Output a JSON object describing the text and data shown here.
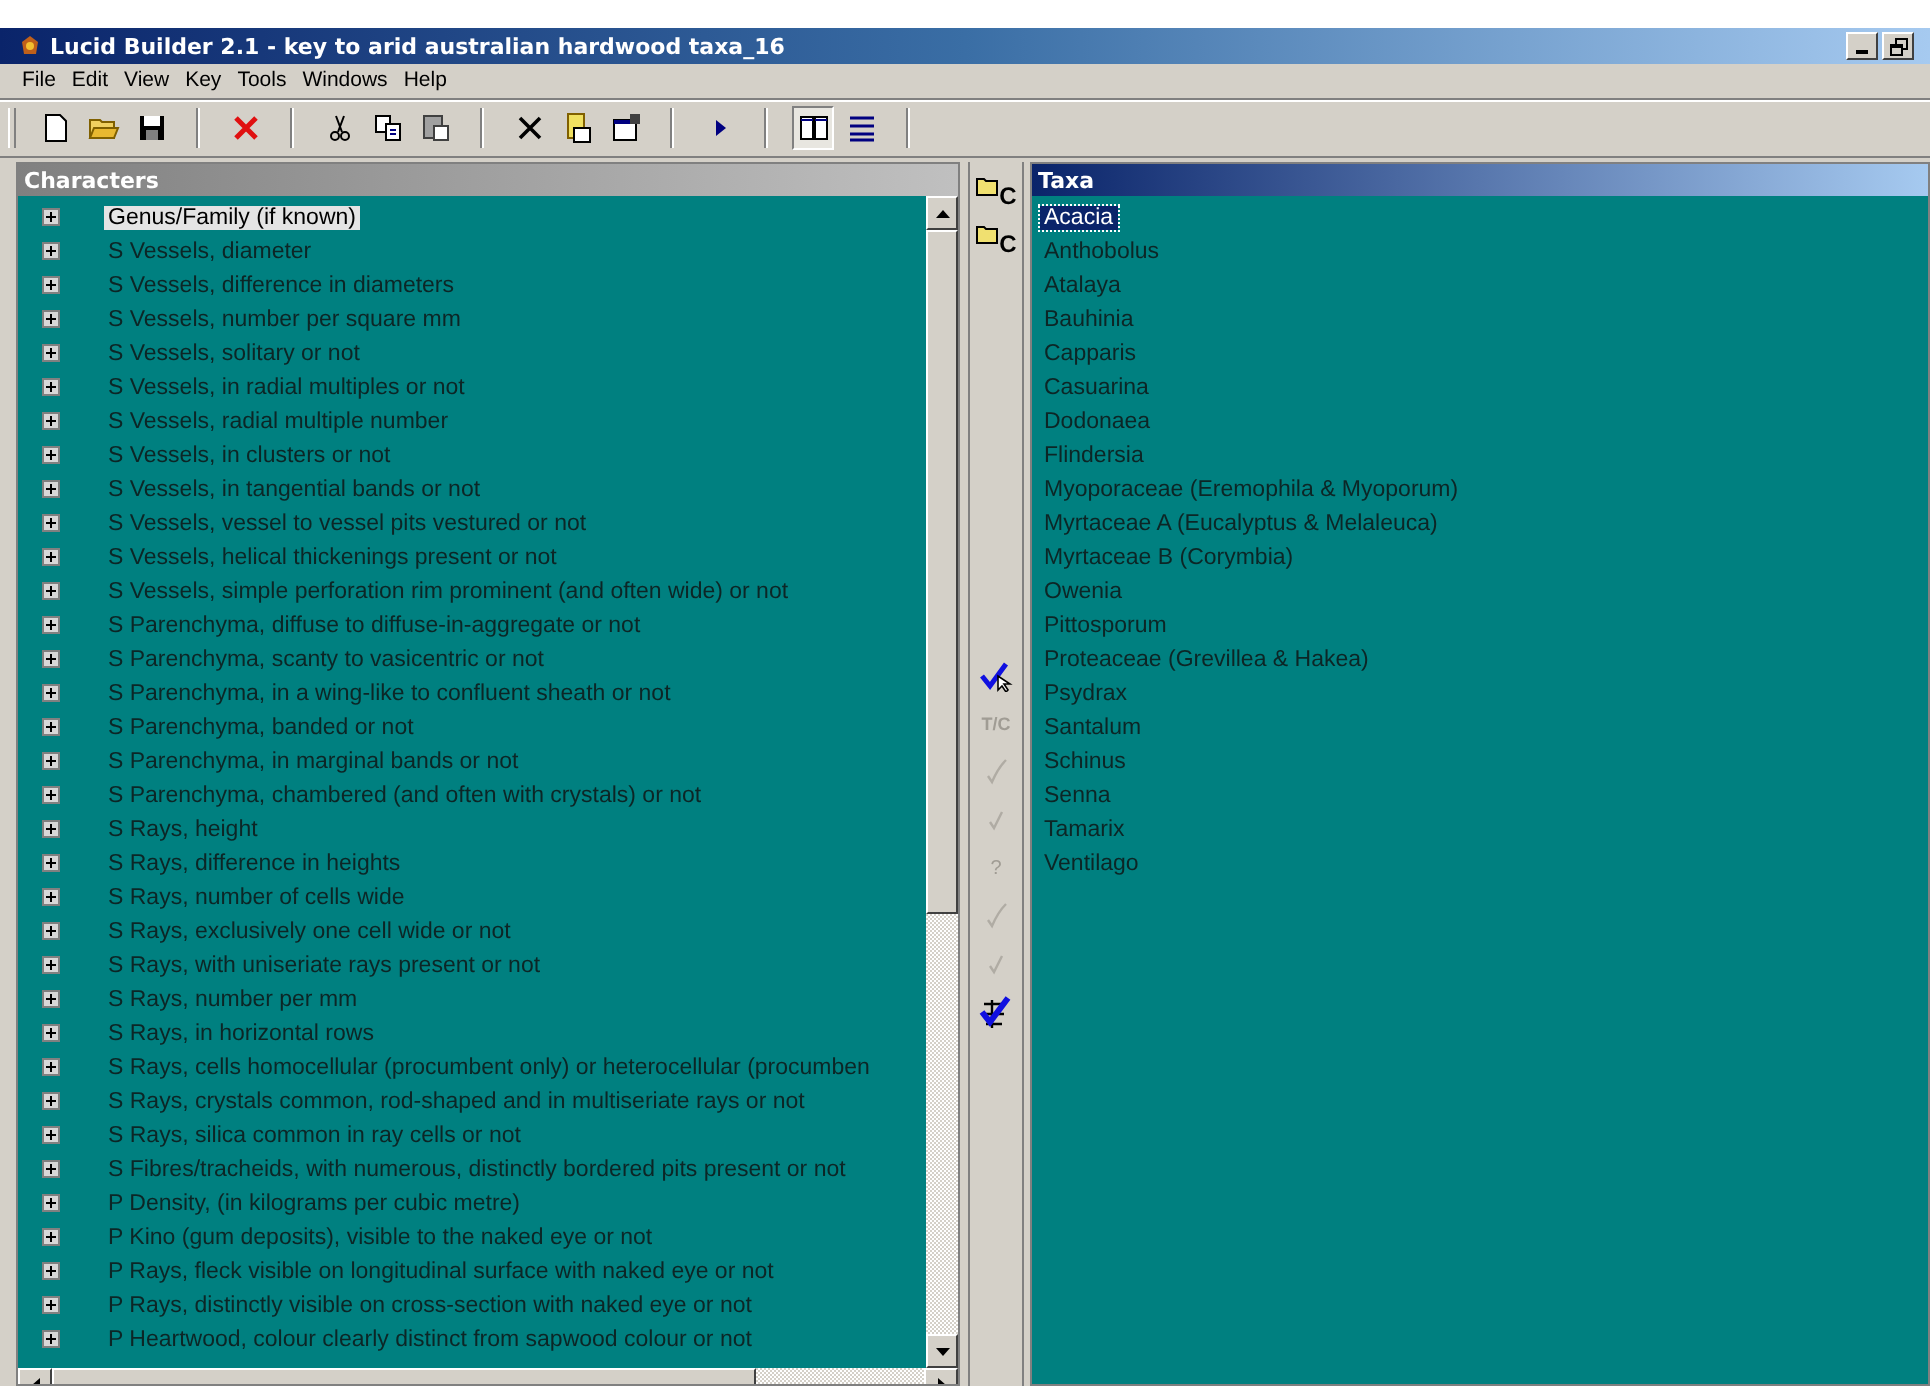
{
  "window": {
    "title": "Lucid Builder 2.1 - key to arid australian hardwood taxa_16"
  },
  "menu": [
    "File",
    "Edit",
    "View",
    "Key",
    "Tools",
    "Windows",
    "Help"
  ],
  "toolbar": [
    {
      "kind": "new"
    },
    {
      "kind": "open"
    },
    {
      "kind": "save"
    },
    {
      "kind": "sep"
    },
    {
      "kind": "delete"
    },
    {
      "kind": "sep"
    },
    {
      "kind": "cut"
    },
    {
      "kind": "copy"
    },
    {
      "kind": "paste"
    },
    {
      "kind": "sep"
    },
    {
      "kind": "remove"
    },
    {
      "kind": "clipboard"
    },
    {
      "kind": "properties"
    },
    {
      "kind": "sep"
    },
    {
      "kind": "run"
    },
    {
      "kind": "sep"
    }
  ],
  "view_toggles": [
    {
      "kind": "columns",
      "selected": true
    },
    {
      "kind": "rows",
      "selected": false
    }
  ],
  "characters": {
    "title": "Characters",
    "items": [
      {
        "label": "Genus/Family (if known)",
        "selected": true
      },
      {
        "label": "S Vessels, diameter",
        "selected": false
      },
      {
        "label": "S Vessels, difference in diameters",
        "selected": false
      },
      {
        "label": "S Vessels, number per square mm",
        "selected": false
      },
      {
        "label": "S Vessels, solitary or not",
        "selected": false
      },
      {
        "label": "S Vessels, in radial multiples or not",
        "selected": false
      },
      {
        "label": "S Vessels, radial multiple number",
        "selected": false
      },
      {
        "label": "S Vessels, in clusters or not",
        "selected": false
      },
      {
        "label": "S Vessels, in tangential bands or not",
        "selected": false
      },
      {
        "label": "S Vessels, vessel to vessel pits vestured or not",
        "selected": false
      },
      {
        "label": "S Vessels, helical thickenings present or not",
        "selected": false
      },
      {
        "label": "S Vessels, simple perforation rim prominent (and often wide) or not",
        "selected": false
      },
      {
        "label": "S Parenchyma, diffuse to diffuse-in-aggregate or not",
        "selected": false
      },
      {
        "label": "S Parenchyma, scanty to vasicentric or not",
        "selected": false
      },
      {
        "label": "S Parenchyma, in a wing-like to confluent sheath or not",
        "selected": false
      },
      {
        "label": "S Parenchyma, banded or not",
        "selected": false
      },
      {
        "label": "S Parenchyma, in marginal bands or not",
        "selected": false
      },
      {
        "label": "S Parenchyma, chambered (and often with crystals) or not",
        "selected": false
      },
      {
        "label": "S Rays, height",
        "selected": false
      },
      {
        "label": "S Rays, difference in heights",
        "selected": false
      },
      {
        "label": "S Rays, number of cells wide",
        "selected": false
      },
      {
        "label": "S Rays, exclusively one cell wide or not",
        "selected": false
      },
      {
        "label": "S Rays, with uniseriate rays present or not",
        "selected": false
      },
      {
        "label": "S Rays, number per mm",
        "selected": false
      },
      {
        "label": "S Rays, in horizontal rows",
        "selected": false
      },
      {
        "label": "S Rays, cells homocellular (procumbent only) or heterocellular (procumben",
        "selected": false
      },
      {
        "label": "S Rays, crystals common, rod-shaped and in multiseriate rays or not",
        "selected": false
      },
      {
        "label": "S Rays, silica common in ray cells or not",
        "selected": false
      },
      {
        "label": "S Fibres/tracheids, with numerous, distinctly bordered pits present or not",
        "selected": false
      },
      {
        "label": "P Density, (in kilograms per cubic metre)",
        "selected": false
      },
      {
        "label": "P Kino (gum deposits), visible to the naked eye or not",
        "selected": false
      },
      {
        "label": "P Rays, fleck visible on longitudinal surface with naked eye or not",
        "selected": false
      },
      {
        "label": "P Rays, distinctly visible on cross-section with naked eye or not",
        "selected": false
      },
      {
        "label": "P Heartwood, colour clearly distinct from sapwood colour or not",
        "selected": false
      }
    ]
  },
  "strip": [
    {
      "kind": "folder",
      "label": "C",
      "disabled": false
    },
    {
      "kind": "folder",
      "label": "C",
      "disabled": false
    },
    {
      "kind": "check-cursor",
      "disabled": false
    },
    {
      "kind": "tc",
      "label": "T/C",
      "disabled": true
    },
    {
      "kind": "check",
      "disabled": true
    },
    {
      "kind": "check-small",
      "disabled": true
    },
    {
      "kind": "question",
      "label": "?",
      "disabled": true
    },
    {
      "kind": "check",
      "disabled": true
    },
    {
      "kind": "check-small",
      "disabled": true
    },
    {
      "kind": "check-tasks",
      "disabled": false
    }
  ],
  "taxa": {
    "title": "Taxa",
    "items": [
      {
        "label": "Acacia",
        "selected": true
      },
      {
        "label": "Anthobolus",
        "selected": false
      },
      {
        "label": "Atalaya",
        "selected": false
      },
      {
        "label": "Bauhinia",
        "selected": false
      },
      {
        "label": "Capparis",
        "selected": false
      },
      {
        "label": "Casuarina",
        "selected": false
      },
      {
        "label": "Dodonaea",
        "selected": false
      },
      {
        "label": "Flindersia",
        "selected": false
      },
      {
        "label": "Myoporaceae (Eremophila & Myoporum)",
        "selected": false
      },
      {
        "label": "Myrtaceae A (Eucalyptus & Melaleuca)",
        "selected": false
      },
      {
        "label": "Myrtaceae B (Corymbia)",
        "selected": false
      },
      {
        "label": "Owenia",
        "selected": false
      },
      {
        "label": "Pittosporum",
        "selected": false
      },
      {
        "label": "Proteaceae (Grevillea & Hakea)",
        "selected": false
      },
      {
        "label": "Psydrax",
        "selected": false
      },
      {
        "label": "Santalum",
        "selected": false
      },
      {
        "label": "Schinus",
        "selected": false
      },
      {
        "label": "Senna",
        "selected": false
      },
      {
        "label": "Tamarix",
        "selected": false
      },
      {
        "label": "Ventilago",
        "selected": false
      }
    ]
  }
}
